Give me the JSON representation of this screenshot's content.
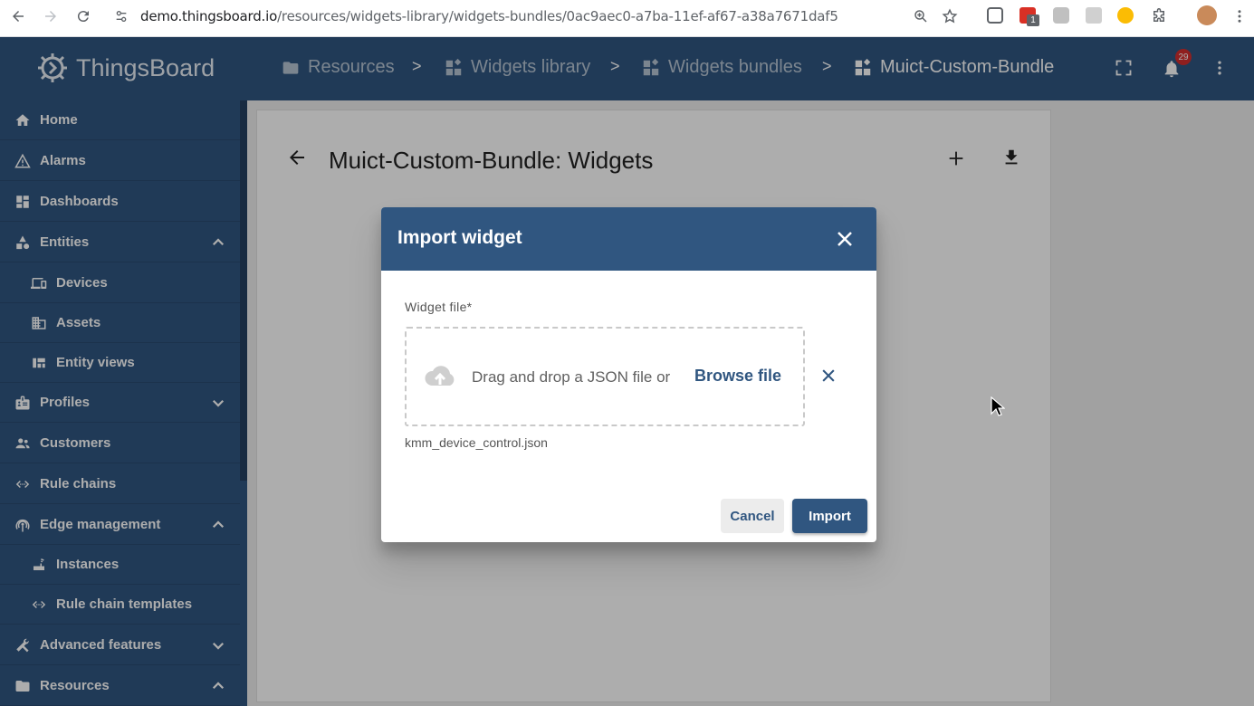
{
  "browser": {
    "url_host": "demo.thingsboard.io",
    "url_path": "/resources/widgets-library/widgets-bundles/0ac9aec0-a7ba-11ef-af67-a38a7671daf5",
    "extension_badge": "1"
  },
  "header": {
    "logo": "ThingsBoard",
    "breadcrumbs": [
      {
        "label": "Resources",
        "icon": "folder-icon"
      },
      {
        "label": "Widgets library",
        "icon": "widgets-icon"
      },
      {
        "label": "Widgets bundles",
        "icon": "widgets-icon"
      },
      {
        "label": "Muict-Custom-Bundle",
        "icon": "widgets-icon"
      }
    ],
    "separator": ">",
    "notification_count": "29"
  },
  "sidebar": {
    "items": [
      {
        "label": "Home",
        "icon": "home-icon"
      },
      {
        "label": "Alarms",
        "icon": "warning-icon"
      },
      {
        "label": "Dashboards",
        "icon": "dashboard-icon"
      },
      {
        "label": "Entities",
        "icon": "category-icon",
        "expanded": true
      },
      {
        "label": "Devices",
        "icon": "devices-icon",
        "sub": true
      },
      {
        "label": "Assets",
        "icon": "domain-icon",
        "sub": true
      },
      {
        "label": "Entity views",
        "icon": "view-quilt-icon",
        "sub": true
      },
      {
        "label": "Profiles",
        "icon": "badge-icon",
        "expanded": false
      },
      {
        "label": "Customers",
        "icon": "supervisor-account-icon"
      },
      {
        "label": "Rule chains",
        "icon": "settings-ethernet-icon"
      },
      {
        "label": "Edge management",
        "icon": "settings-input-antenna-icon",
        "expanded": true
      },
      {
        "label": "Instances",
        "icon": "router-icon",
        "sub": true
      },
      {
        "label": "Rule chain templates",
        "icon": "settings-ethernet-icon",
        "sub": true
      },
      {
        "label": "Advanced features",
        "icon": "construction-icon",
        "expanded": false
      },
      {
        "label": "Resources",
        "icon": "folder-icon",
        "expanded": true
      }
    ]
  },
  "page": {
    "title": "Muict-Custom-Bundle: Widgets"
  },
  "dialog": {
    "title": "Import widget",
    "field_label": "Widget file*",
    "dropzone_text": "Drag and drop a JSON file or",
    "browse_label": "Browse file",
    "selected_file": "kmm_device_control.json",
    "cancel_label": "Cancel",
    "import_label": "Import"
  },
  "colors": {
    "primary": "#305680",
    "badge": "#d32f2f"
  }
}
